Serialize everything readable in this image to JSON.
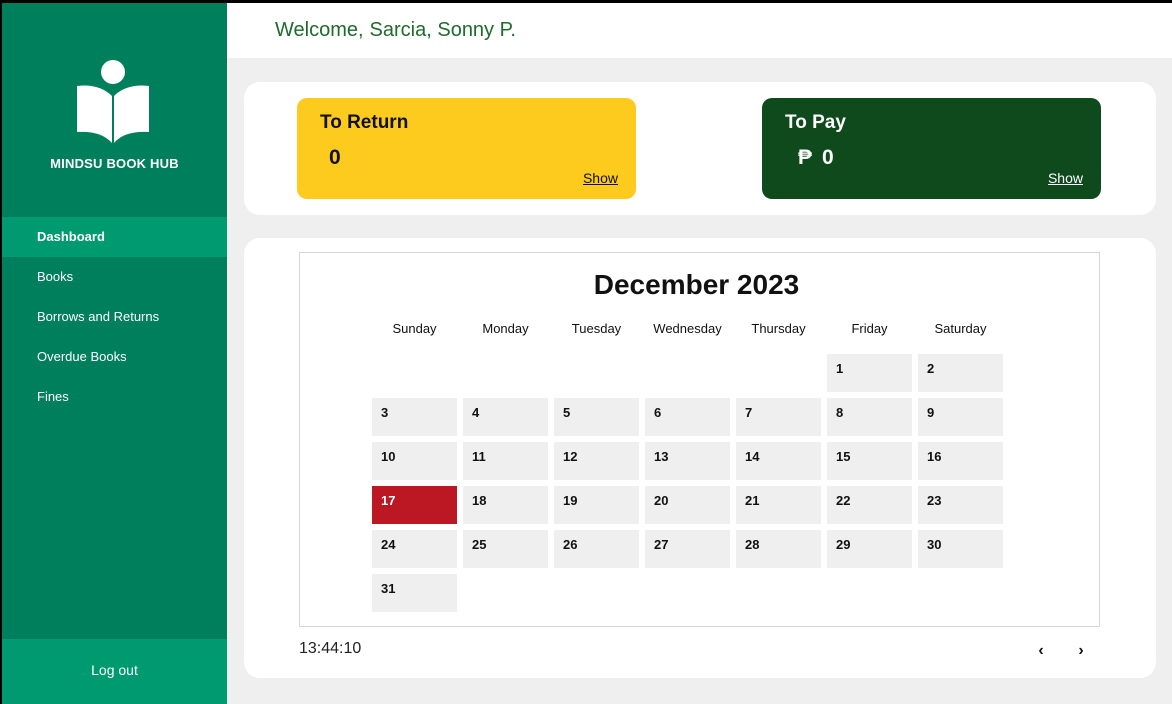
{
  "sidebar": {
    "brand": "MINDSU BOOK HUB",
    "items": [
      {
        "label": "Dashboard",
        "active": true
      },
      {
        "label": "Books",
        "active": false
      },
      {
        "label": "Borrows and Returns",
        "active": false
      },
      {
        "label": "Overdue Books",
        "active": false
      },
      {
        "label": "Fines",
        "active": false
      }
    ],
    "logout_label": "Log out"
  },
  "header": {
    "welcome_prefix": "Welcome,",
    "user_name": "Sarcia, Sonny P."
  },
  "summary": {
    "to_return": {
      "title": "To Return",
      "value": "0",
      "show_label": "Show"
    },
    "to_pay": {
      "title": "To Pay",
      "currency": "₱",
      "value": "0",
      "show_label": "Show"
    }
  },
  "calendar": {
    "title": "December 2023",
    "weekdays": [
      "Sunday",
      "Monday",
      "Tuesday",
      "Wednesday",
      "Thursday",
      "Friday",
      "Saturday"
    ],
    "first_weekday_index": 5,
    "days_in_month": 31,
    "today": 17,
    "prev_label": "‹",
    "next_label": "›"
  },
  "clock": "13:44:10",
  "colors": {
    "sidebar": "#007f5c",
    "sidebar_active": "#009a70",
    "return_card": "#fdca1e",
    "pay_card": "#0e4a1b",
    "today": "#bb1823",
    "welcome_text": "#1e6b2a"
  }
}
